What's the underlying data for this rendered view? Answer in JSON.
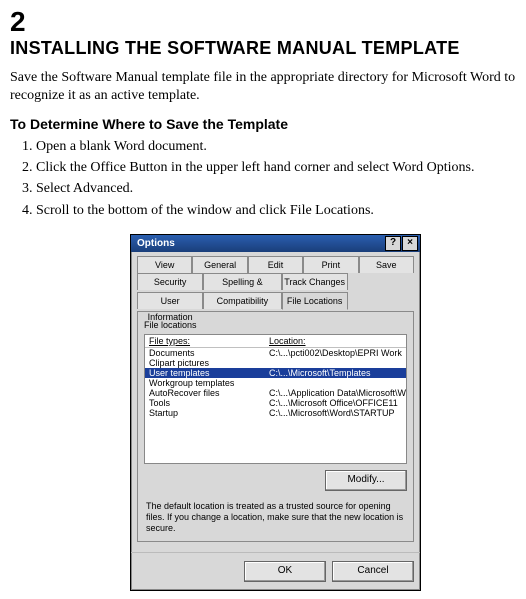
{
  "doc": {
    "chapter_number": "2",
    "title": "INSTALLING THE SOFTWARE MANUAL TEMPLATE",
    "intro": "Save the Software Manual template file in the appropriate directory for Microsoft Word to recognize it as an active template.",
    "subhead": "To Determine Where to Save the Template",
    "steps": [
      "Open a blank Word document.",
      "Click the Office Button in the upper left hand corner and select Word Options.",
      "Select Advanced.",
      "Scroll to the bottom of the window and click File Locations."
    ]
  },
  "dialog": {
    "title": "Options",
    "help_btn": "?",
    "close_btn": "×",
    "tabs_row1": [
      "View",
      "General",
      "Edit",
      "Print",
      "Save"
    ],
    "tabs_row2": [
      "Security",
      "User Information",
      "Spelling & Grammar",
      "Compatibility",
      "Track Changes",
      "File Locations"
    ],
    "active_tab": "File Locations",
    "section_label": "File locations",
    "col1": "File types:",
    "col2": "Location:",
    "rows": [
      {
        "type": "Documents",
        "loc": "C:\\...\\pcti002\\Desktop\\EPRI Work"
      },
      {
        "type": "Clipart pictures",
        "loc": ""
      },
      {
        "type": "User templates",
        "loc": "C:\\...\\Microsoft\\Templates",
        "selected": true
      },
      {
        "type": "Workgroup templates",
        "loc": ""
      },
      {
        "type": "AutoRecover files",
        "loc": "C:\\...\\Application Data\\Microsoft\\Word"
      },
      {
        "type": "Tools",
        "loc": "C:\\...\\Microsoft Office\\OFFICE11"
      },
      {
        "type": "Startup",
        "loc": "C:\\...\\Microsoft\\Word\\STARTUP"
      }
    ],
    "modify_btn": "Modify...",
    "disclaimer": "The default location is treated as a trusted source for opening files. If you change a location, make sure that the new location is secure.",
    "ok_btn": "OK",
    "cancel_btn": "Cancel"
  }
}
